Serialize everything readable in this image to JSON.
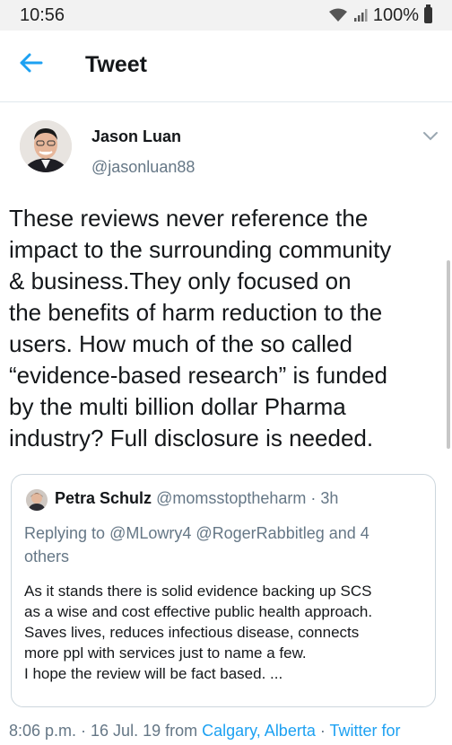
{
  "status_bar": {
    "time": "10:56",
    "battery": "100%",
    "icons": [
      "wifi-icon",
      "signal-icon",
      "battery-icon"
    ]
  },
  "app_bar": {
    "back_icon": "back-arrow-icon",
    "title": "Tweet"
  },
  "tweet": {
    "author": {
      "name": "Jason Luan",
      "handle": "@jasonluan88"
    },
    "menu_icon": "chevron-down-icon",
    "text_lines": [
      "These reviews never reference the",
      "impact to the surrounding community",
      "& business.They only focused on",
      "the benefits of harm reduction to the",
      "users. How much of the so called",
      "“evidence-based research” is funded",
      "by the multi billion dollar Pharma",
      "industry? Full disclosure is needed."
    ],
    "quote": {
      "name": "Petra Schulz",
      "handle_time": "@momsstoptheharm · 3h",
      "replying_prefix": "Replying to",
      "replying_mentions": "@MLowry4 @RogerRabbitleg",
      "replying_suffix": "and 4",
      "replying_suffix2": "others",
      "body_lines": [
        "As it stands there is solid evidence backing up SCS",
        "as a wise and cost effective public health approach.",
        "Saves lives, reduces infectious disease, connects",
        "more ppl with services  just to name a few.",
        "I hope the review will be fact based. ..."
      ]
    },
    "meta": {
      "timestamp": "8:06 p.m. · 16 Jul. 19 from ",
      "location": "Calgary, Alberta",
      "separator": " · ",
      "source": "Twitter for"
    }
  },
  "colors": {
    "accent": "#1da1f2",
    "text": "#14171a",
    "secondary": "#657786",
    "border": "#ccd6dd"
  }
}
